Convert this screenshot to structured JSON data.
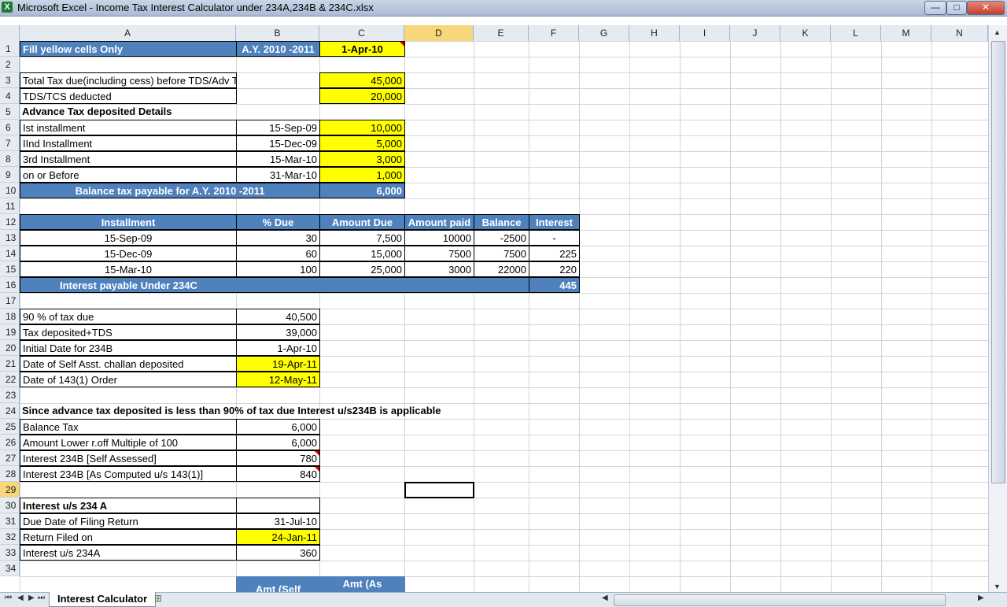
{
  "window": {
    "title": "Microsoft Excel - Income Tax Interest Calculator under 234A,234B & 234C.xlsx",
    "app_icon": "X",
    "min": "—",
    "max": "□",
    "close": "✕"
  },
  "columns": [
    "A",
    "B",
    "C",
    "D",
    "E",
    "F",
    "G",
    "H",
    "I",
    "J",
    "K",
    "L",
    "M",
    "N"
  ],
  "rows": [
    "1",
    "2",
    "3",
    "4",
    "5",
    "6",
    "7",
    "8",
    "9",
    "10",
    "11",
    "12",
    "13",
    "14",
    "15",
    "16",
    "17",
    "18",
    "19",
    "20",
    "21",
    "22",
    "23",
    "24",
    "25",
    "26",
    "27",
    "28",
    "29",
    "30",
    "31",
    "32",
    "33",
    "34"
  ],
  "cells": {
    "a1": "Fill yellow cells Only",
    "b1": "A.Y. 2010 -2011",
    "c1": "1-Apr-10",
    "a3": "Total Tax due(including cess) before TDS/Adv Tax",
    "c3": "45,000",
    "a4": "TDS/TCS deducted",
    "c4": "20,000",
    "a5": "Advance Tax deposited Details",
    "a6": " Ist installment",
    "b6": "15-Sep-09",
    "c6": "10,000",
    "a7": " IInd Installment",
    "b7": "15-Dec-09",
    "c7": "5,000",
    "a8": "3rd Installment",
    "b8": "15-Mar-10",
    "c8": "3,000",
    "a9": "on or Before",
    "b9": "31-Mar-10",
    "c9": "1,000",
    "a10": "Balance tax payable for A.Y.  2010 -2011",
    "c10": "6,000",
    "a12": "Installment",
    "b12": "% Due",
    "c12": "Amount Due",
    "d12": "Amount paid",
    "e12": "Balance",
    "f12": "Interest",
    "a13": "15-Sep-09",
    "b13": "30",
    "c13": "7,500",
    "d13": "10000",
    "e13": "-2500",
    "f13": "-",
    "a14": "15-Dec-09",
    "b14": "60",
    "c14": "15,000",
    "d14": "7500",
    "e14": "7500",
    "f14": "225",
    "a15": "15-Mar-10",
    "b15": "100",
    "c15": "25,000",
    "d15": "3000",
    "e15": "22000",
    "f15": "220",
    "a16": "Interest payable Under 234C",
    "f16": "445",
    "a18": "90 % of tax due",
    "b18": "40,500",
    "a19": "Tax deposited+TDS",
    "b19": "39,000",
    "a20": "Initial Date for 234B",
    "b20": "1-Apr-10",
    "a21": "Date of Self Asst. challan deposited",
    "b21": "19-Apr-11",
    "a22": "Date of 143(1) Order",
    "b22": "12-May-11",
    "a24": " Since advance tax deposited is less than 90% of tax due Interest u/s234B is applicable",
    "a25": "Balance Tax",
    "b25": "6,000",
    "a26": "Amount Lower r.off Multiple of 100",
    "b26": "6,000",
    "a27": "  Interest 234B [Self Assessed]",
    "b27": "780",
    "a28": "Interest 234B [As Computed u/s 143(1)]",
    "b28": "840",
    "a30": "Interest u/s 234 A",
    "a31": "Due Date of Filing Return",
    "b31": "31-Jul-10",
    "a32": "Return Filed on",
    "b32": "24-Jan-11",
    "a33": "Interest u/s 234A",
    "b33": "360",
    "b35": "Amt (Self",
    "c35": "Amt (As"
  },
  "sheet_tab": "Interest Calculator"
}
